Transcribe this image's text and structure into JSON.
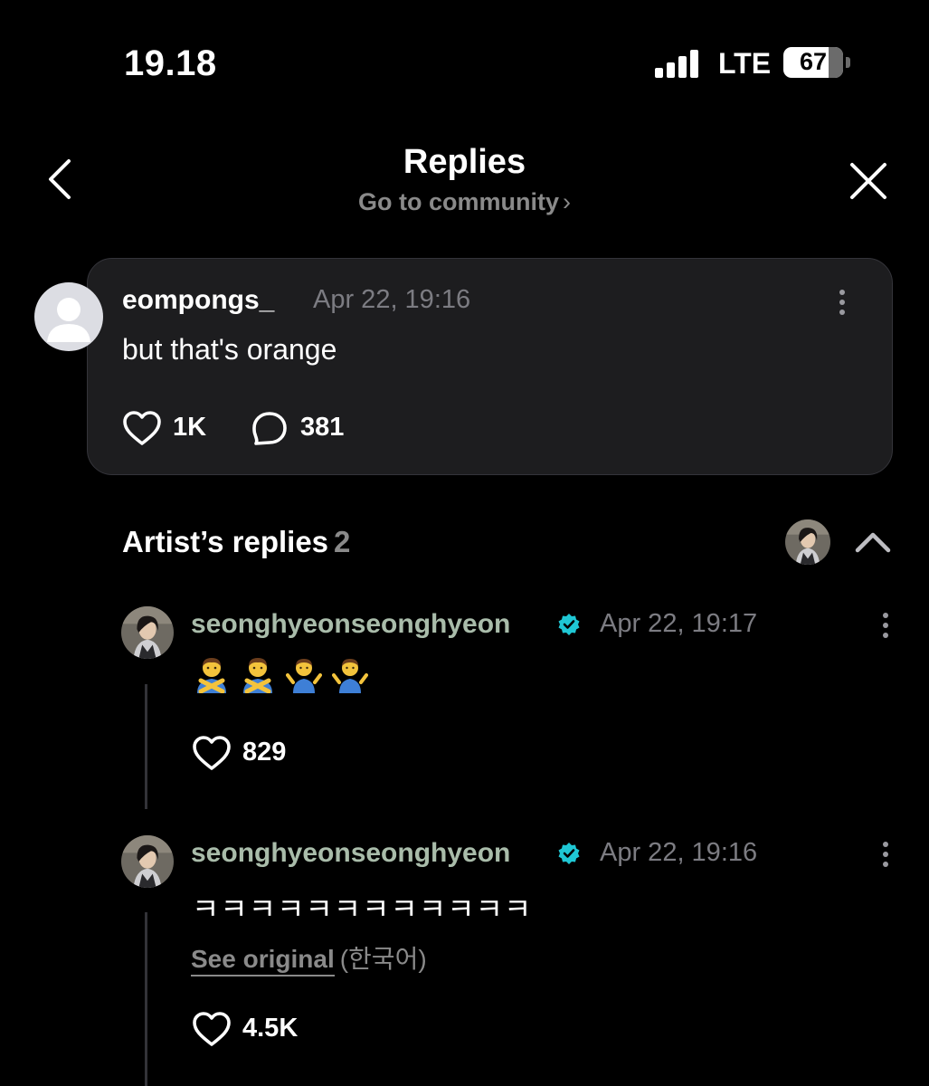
{
  "status_bar": {
    "time": "19.18",
    "network": "LTE",
    "battery": "67",
    "battery_level": 0.67
  },
  "header": {
    "title": "Replies",
    "community_link": "Go to community",
    "community_chevron": "›"
  },
  "parent_comment": {
    "username": "eompongs_",
    "date": "Apr 22, 19:16",
    "text": "but that's orange",
    "likes": "1K",
    "replies": "381"
  },
  "artist_replies": {
    "label": "Artist’s replies",
    "count": "2",
    "items": [
      {
        "username": "seonghyeonseonghyeon",
        "date": "Apr 22, 19:17",
        "emojis": [
          "man-gesturing-no",
          "man-gesturing-no",
          "man-shrugging",
          "man-shrugging"
        ],
        "likes": "829"
      },
      {
        "username": "seonghyeonseonghyeon",
        "date": "Apr 22, 19:16",
        "text": "ㅋㅋㅋㅋㅋㅋㅋㅋㅋㅋㅋㅋ",
        "see_original": "See original",
        "original_language": "(한국어)",
        "likes": "4.5K"
      }
    ]
  },
  "colors": {
    "background": "#000000",
    "card": "#1d1d1f",
    "artist_name": "#a9bcaa",
    "verified_badge": "#1fc7d4",
    "muted_text": "#8a8a8a"
  }
}
